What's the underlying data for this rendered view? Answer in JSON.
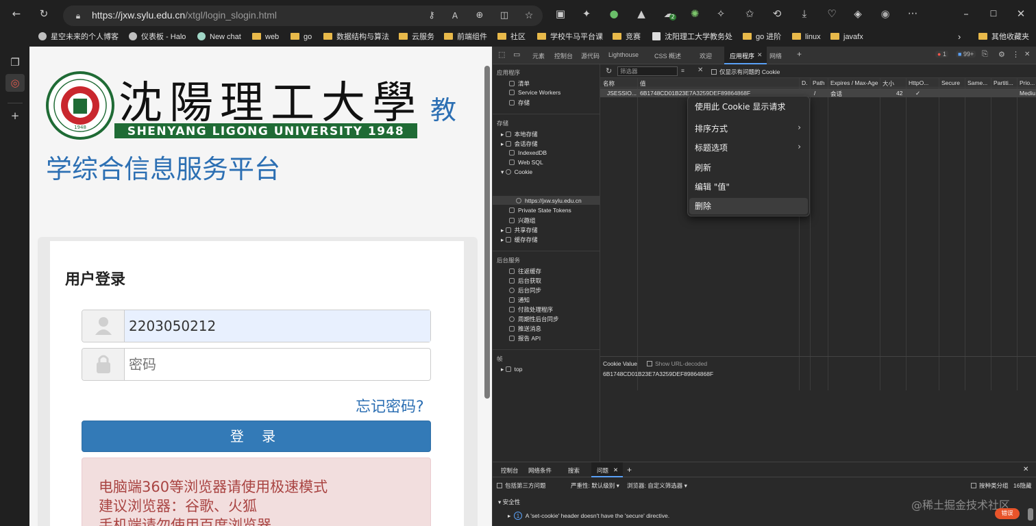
{
  "browser": {
    "url_host": "https://jxw.sylu.edu.cn",
    "url_path": "/xtgl/login_slogin.html"
  },
  "bookmarks": [
    {
      "label": "星空未来的个人博客",
      "icon": "page-icon"
    },
    {
      "label": "仪表板 - Halo",
      "icon": "page-icon"
    },
    {
      "label": "New chat",
      "icon": "chatgpt-icon"
    },
    {
      "label": "web",
      "icon": "folder-icon"
    },
    {
      "label": "go",
      "icon": "folder-icon"
    },
    {
      "label": "数据结构与算法",
      "icon": "folder-icon"
    },
    {
      "label": "云服务",
      "icon": "folder-icon"
    },
    {
      "label": "前端组件",
      "icon": "folder-icon"
    },
    {
      "label": "社区",
      "icon": "folder-icon"
    },
    {
      "label": "学校牛马平台课",
      "icon": "folder-icon"
    },
    {
      "label": "竞赛",
      "icon": "folder-icon"
    },
    {
      "label": "沈阳理工大学教务处",
      "icon": "page-icon"
    },
    {
      "label": "go 进阶",
      "icon": "folder-icon"
    },
    {
      "label": "linux",
      "icon": "folder-icon"
    },
    {
      "label": "javafx",
      "icon": "folder-icon"
    }
  ],
  "bookmarks_other": "其他收藏夹",
  "ext_badge": "2",
  "page": {
    "logo_text": "SHENYANG LIGONG UNIVERSITY 1948",
    "logo_calligraphy": "沈陽理工大學",
    "seal_year": "1948",
    "title_line1": "教",
    "title_line2": "学综合信息服务平台",
    "login_heading": "用户登录",
    "username_value": "2203050212",
    "password_placeholder": "密码",
    "forgot": "忘记密码?",
    "login_button": "登 录",
    "alert_lines": [
      "电脑端360等浏览器请使用极速模式",
      "建议浏览器：谷歌、火狐",
      "手机端请勿使用百度浏览器"
    ]
  },
  "devtools": {
    "tabs": [
      "元素",
      "控制台",
      "源代码",
      "Lighthouse",
      "CSS 概述",
      "欢迎",
      "应用程序",
      "网络"
    ],
    "error_count": "1",
    "issue_count": "99+",
    "sidebar": {
      "app_header": "应用程序",
      "app_items": [
        "清单",
        "Service Workers",
        "存储"
      ],
      "storage_header": "存储",
      "storage_items": [
        "本地存储",
        "会话存储",
        "IndexedDB",
        "Web SQL",
        "Cookie"
      ],
      "cookie_origin": "https://jxw.sylu.edu.cn",
      "storage_items2": [
        "Private State Tokens",
        "兴趣组",
        "共享存储",
        "缓存存储"
      ],
      "bg_header": "后台服务",
      "bg_items": [
        "往返缓存",
        "后台获取",
        "后台同步",
        "通知",
        "付款处理程序",
        "周期性后台同步",
        "推送消息",
        "报告 API"
      ],
      "frames_header": "帧",
      "frames_item": "top"
    },
    "filter_placeholder": "筛选器",
    "only_issues": "仅显示有问题的 Cookie",
    "columns": [
      "名称",
      "值",
      "D.",
      "Path",
      "Expires / Max-Age",
      "大小",
      "HttpO...",
      "Secure",
      "Same...",
      "Partiti...",
      "Prio..."
    ],
    "row": {
      "name": "JSESSIO...",
      "value": "6B1748CD01B23E7A3259DEF89864868F",
      "path": "/",
      "expires": "会话",
      "size": "42",
      "httponly": "✓",
      "priority": "Mediu..."
    },
    "context_menu": [
      "使用此 Cookie 显示请求",
      "排序方式",
      "标题选项",
      "刷新",
      "编辑 \"值\"",
      "删除"
    ],
    "cookie_value_label": "Cookie Value",
    "show_decoded": "Show URL-decoded",
    "cookie_value": "6B1748CD01B23E7A3259DEF89864868F",
    "drawer_tabs": [
      "控制台",
      "网络条件",
      "搜索",
      "问题"
    ],
    "include_third": "包括第三方问题",
    "severity": "严重性: 默认级别",
    "browser_label": "浏览器: 自定义筛选器",
    "group_by_kind": "按种类分组",
    "hidden_count": "16隐藏",
    "security_group": "安全性",
    "issue_count_badge": "1",
    "issue_text": "A 'set-cookie' header doesn't have the 'secure' directive."
  },
  "watermark": "@稀土掘金技术社区",
  "error_badge": "错误",
  "colors": {
    "accent": "#2c6fb3",
    "button": "#337ab7",
    "alert_text": "#a94442",
    "devtools_bg": "#292929"
  }
}
